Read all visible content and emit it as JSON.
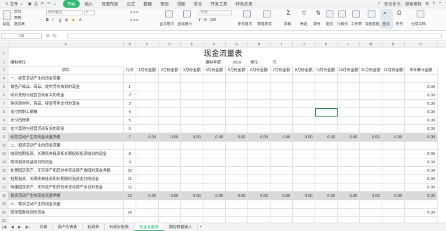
{
  "menu": {
    "file": "文件",
    "tabs": [
      "开始",
      "插入",
      "页面布局",
      "公式",
      "数据",
      "审阅",
      "视图",
      "安全",
      "开发工具",
      "特色应用"
    ],
    "active_tab": 0,
    "search": "查找命令、搜索模板"
  },
  "ribbon": {
    "cut": "剪切",
    "paste": "粘贴",
    "copy": "复制",
    "format_painter": "格式刷",
    "font_name": "微软雅黑",
    "font_size": "9",
    "merge": "合并居中",
    "wrap": "自动换行",
    "number_format": "数值",
    "cond_format": "条件格式",
    "table_style": "表格样式",
    "sum": "求和",
    "filter": "筛选",
    "sort": "排序",
    "format": "格式",
    "rowcol": "行和列",
    "worksheet": "工作表",
    "freeze": "冻结窗格",
    "find": "查找",
    "symbol": "符号",
    "share": "分享文档"
  },
  "formula_bar": {
    "name_box": "K8",
    "fx": "fx"
  },
  "grid": {
    "columns": [
      "A",
      "B",
      "C",
      "D",
      "E",
      "F",
      "G",
      "H",
      "I",
      "J",
      "K",
      "L",
      "M",
      "N",
      "O"
    ],
    "rows": [
      "1",
      "2",
      "3",
      "4",
      "5",
      "6",
      "7",
      "8",
      "9",
      "10",
      "11",
      "12",
      "13",
      "14",
      "15",
      "16",
      "17",
      "18",
      "19",
      "20",
      "21"
    ],
    "title": "现金流量表",
    "unit_label": "编制单位:",
    "year_label": "编制年度:",
    "year_value": "2019",
    "currency_label": "单位:",
    "currency_value": "元",
    "header": {
      "item": "项目",
      "line": "行次",
      "months": [
        "1月份金额",
        "2月份金额",
        "3月份金额",
        "4月份金额",
        "5月份金额",
        "6月份金额",
        "7月份金额",
        "8月份金额",
        "9月份金额",
        "10月份金额",
        "11月份金额",
        "12月份金额"
      ],
      "total": "本年累计金额"
    },
    "items": [
      {
        "label": "一、经营活动产生的现金流量:",
        "line": "",
        "total": "",
        "gray": false,
        "sum": false
      },
      {
        "label": "销售产成品、商品、提供劳务收到的现金",
        "line": "1",
        "total": "0.00",
        "gray": false,
        "sum": false
      },
      {
        "label": "收到其他与经营活动有关的现金",
        "line": "2",
        "total": "0.00",
        "gray": false,
        "sum": false
      },
      {
        "label": "购买原材料、商品、接受劳务支付的现金",
        "line": "3",
        "total": "0.00",
        "gray": false,
        "sum": false
      },
      {
        "label": "支付的职工薪酬",
        "line": "4",
        "total": "0.00",
        "gray": false,
        "sum": false
      },
      {
        "label": "支付的税费",
        "line": "5",
        "total": "0.00",
        "gray": false,
        "sum": false
      },
      {
        "label": "支付其他与经营活动有关的现金",
        "line": "6",
        "total": "0.00",
        "gray": false,
        "sum": false
      },
      {
        "label": "经营活动产生的现金流量净额",
        "line": "7",
        "total": "0.00",
        "gray": true,
        "sum": true
      },
      {
        "label": "二、投资活动产生的现金流量:",
        "line": "",
        "total": "",
        "gray": false,
        "sum": false
      },
      {
        "label": "收回短期投资、长期债券投资和长期股权投资收到的现金",
        "line": "8",
        "total": "0.00",
        "gray": false,
        "sum": false
      },
      {
        "label": "取得投资收益收到的现金",
        "line": "9",
        "total": "0.00",
        "gray": false,
        "sum": false
      },
      {
        "label": "处置固定资产、无形资产和其他非流动资产收回的现金净额",
        "line": "10",
        "total": "0.00",
        "gray": false,
        "sum": false
      },
      {
        "label": "短期投资、长期债券投资和长期股权投资支付的现金",
        "line": "11",
        "total": "0.00",
        "gray": false,
        "sum": false
      },
      {
        "label": "购建固定资产、无形资产和其他非流动资产支付的现金",
        "line": "12",
        "total": "0.00",
        "gray": false,
        "sum": false
      },
      {
        "label": "投资活动产生的现金流量净额",
        "line": "13",
        "total": "0.00",
        "gray": true,
        "sum": true
      },
      {
        "label": "三、筹资活动产生的现金流量:",
        "line": "",
        "total": "",
        "gray": false,
        "sum": false
      },
      {
        "label": "取得借款收到的现金",
        "line": "14",
        "total": "0.00",
        "gray": false,
        "sum": false
      }
    ],
    "zero": "0.00"
  },
  "sheets": {
    "tabs": [
      "目录",
      "资产负债表",
      "利润表",
      "利润分配表",
      "现金流量表",
      "期初数据录入"
    ],
    "active": 4
  }
}
